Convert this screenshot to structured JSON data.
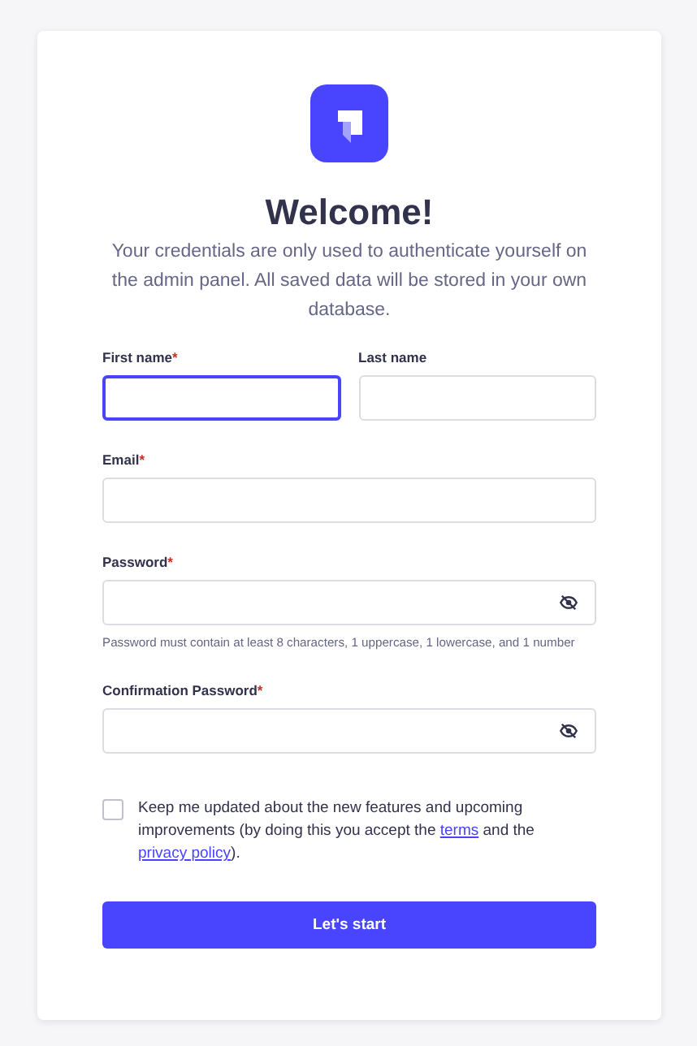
{
  "title": "Welcome!",
  "subtitle": "Your credentials are only used to authenticate yourself on the admin panel. All saved data will be stored in your own database.",
  "rows": [
    {
      "fields": [
        {
          "label": "First name",
          "required_mark": "*",
          "focused": true,
          "kind": "text"
        },
        {
          "label": "Last name",
          "focused": false,
          "kind": "text"
        }
      ]
    },
    {
      "fields": [
        {
          "label": "Email",
          "required_mark": "*",
          "focused": false,
          "kind": "text"
        }
      ]
    },
    {
      "fields": [
        {
          "label": "Password",
          "required_mark": "*",
          "focused": false,
          "kind": "password",
          "hint": "Password must contain at least 8 characters, 1 uppercase, 1 lowercase, and 1 number"
        }
      ]
    },
    {
      "fields": [
        {
          "label": "Confirmation Password",
          "required_mark": "*",
          "focused": false,
          "kind": "password"
        }
      ]
    }
  ],
  "consent": {
    "checked": false,
    "text_before": "Keep me updated about the new features and upcoming improvements (by doing this you accept the ",
    "terms_link": "terms",
    "text_middle": " and the ",
    "privacy_link": "privacy policy",
    "text_after": ")."
  },
  "submit_button": "Let's start"
}
